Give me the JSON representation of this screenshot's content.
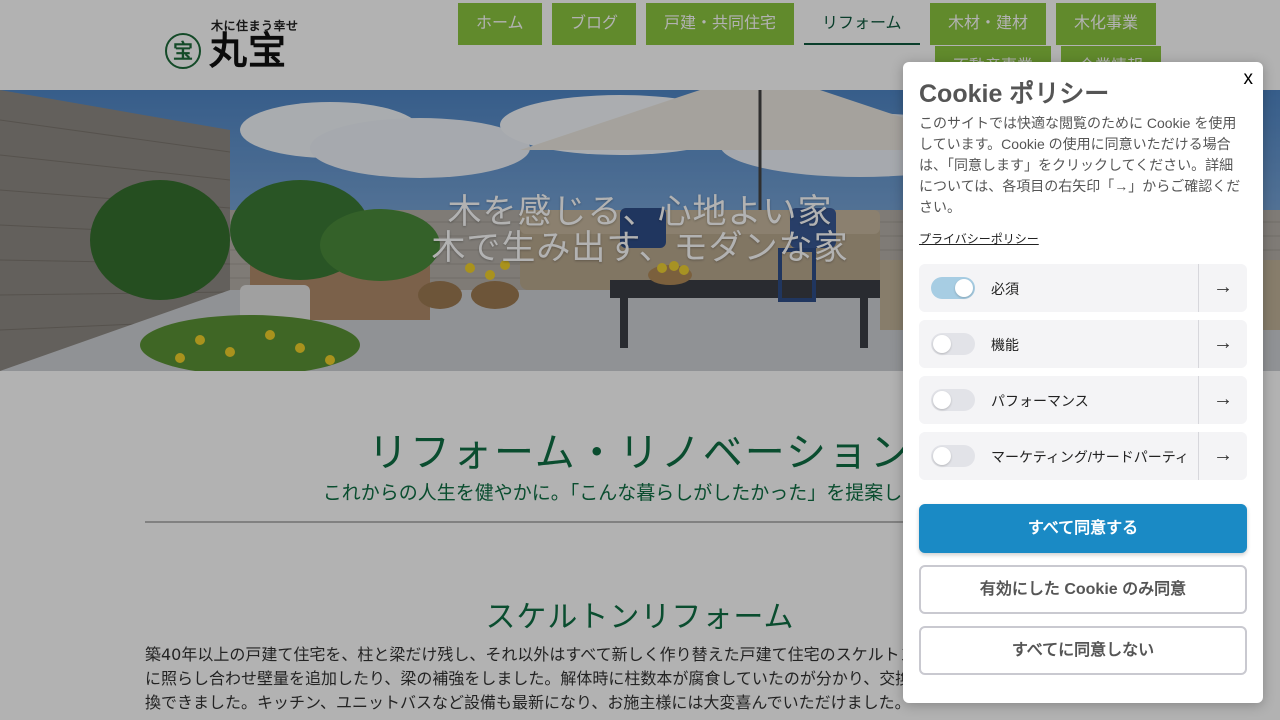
{
  "header": {
    "logo": {
      "tagline": "木に住まう幸せ",
      "seal": "宝",
      "name": "丸宝"
    },
    "nav": [
      {
        "label": "ホーム",
        "active": false
      },
      {
        "label": "ブログ",
        "active": false
      },
      {
        "label": "戸建・共同住宅",
        "active": false
      },
      {
        "label": "リフォーム",
        "active": true
      },
      {
        "label": "木材・建材",
        "active": false
      },
      {
        "label": "木化事業",
        "active": false
      },
      {
        "label": "不動産事業",
        "active": false
      },
      {
        "label": "企業情報",
        "active": false
      }
    ]
  },
  "hero": {
    "line1": "木を感じる、心地よい家",
    "line2": "木で生み出す、モダンな家"
  },
  "content": {
    "title": "リフォーム・リノベーション",
    "subtitle": "これからの人生を健やかに。「こんな暮らしがしたかった」を提案します。",
    "section_title": "スケルトンリフォーム",
    "body": "築40年以上の戸建て住宅を、柱と梁だけ残し、それ以外はすべて新しく作り替えた戸建て住宅のスケルトンリフォームです。現行の耐震基準に照らし合わせ壁量を追加したり、梁の補強をしました。解体時に柱数本が腐食していたのが分かり、交換が必要な柱もありましたが無事交換できました。キッチン、ユニットバスなど設備も最新になり、お施主様には大変喜んでいただけました。"
  },
  "cookie": {
    "close": "x",
    "title": "Cookie ポリシー",
    "description": "このサイトでは快適な閲覧のために Cookie を使用しています。Cookie の使用に同意いただける場合は、「同意します」をクリックしてください。詳細については、各項目の右矢印「→」からご確認ください。",
    "privacy_link": "プライバシーポリシー",
    "categories": [
      {
        "label": "必須",
        "enabled": true
      },
      {
        "label": "機能",
        "enabled": false
      },
      {
        "label": "パフォーマンス",
        "enabled": false
      },
      {
        "label": "マーケティング/サードパーティ",
        "enabled": false
      }
    ],
    "arrow": "→",
    "buttons": {
      "accept_all": "すべて同意する",
      "accept_selected": "有効にした Cookie のみ同意",
      "reject_all": "すべてに同意しない"
    }
  },
  "colors": {
    "nav_green": "#8cc63f",
    "heading_green": "#0f6f44",
    "primary_blue": "#1a8ac5"
  }
}
